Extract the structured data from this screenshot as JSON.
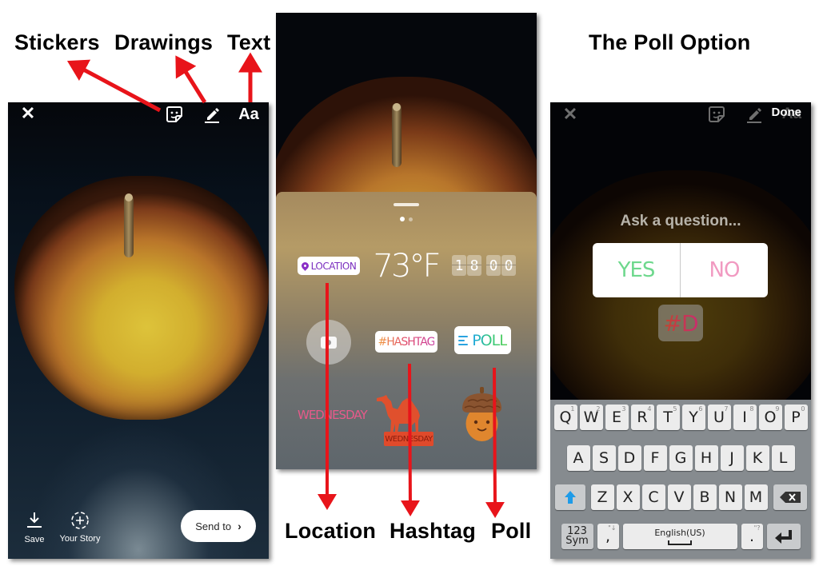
{
  "captions": {
    "stickers": "Stickers",
    "drawings": "Drawings",
    "text": "Text",
    "poll_option": "The Poll Option",
    "location": "Location",
    "hashtag": "Hashtag",
    "poll": "Poll"
  },
  "panel_editor": {
    "close_icon": "close-icon",
    "sticker_icon": "sticker-icon",
    "draw_icon": "pen-icon",
    "text_button": "Aa",
    "save_label": "Save",
    "your_story_label": "Your Story",
    "send_to_label": "Send to",
    "send_to_chevron": "›"
  },
  "panel_stickers": {
    "location_label": "LOCATION",
    "temperature": "73°F",
    "clock_digits": [
      "1",
      "8",
      "0",
      "0"
    ],
    "hashtag_label": "#HASHTAG",
    "poll_label": "POLL",
    "day_sticker": "WEDNESDAY",
    "day_badge": "WEDNESDAY",
    "page_indicator": {
      "current": 1,
      "total": 2
    }
  },
  "panel_poll": {
    "done_label": "Done",
    "text_button": "Aa",
    "question_placeholder": "Ask a question...",
    "option_yes": "YES",
    "option_no": "NO",
    "hashtag_draft": "#D",
    "keyboard": {
      "row1": [
        {
          "key": "Q",
          "sup": "1"
        },
        {
          "key": "W",
          "sup": "2"
        },
        {
          "key": "E",
          "sup": "3"
        },
        {
          "key": "R",
          "sup": "4"
        },
        {
          "key": "T",
          "sup": "5"
        },
        {
          "key": "Y",
          "sup": "6"
        },
        {
          "key": "U",
          "sup": "7"
        },
        {
          "key": "I",
          "sup": "8"
        },
        {
          "key": "O",
          "sup": "9"
        },
        {
          "key": "P",
          "sup": "0"
        }
      ],
      "row2": [
        "A",
        "S",
        "D",
        "F",
        "G",
        "H",
        "J",
        "K",
        "L"
      ],
      "row3": [
        "Z",
        "X",
        "C",
        "V",
        "B",
        "N",
        "M"
      ],
      "sym_top": "123",
      "sym_bottom": "Sym",
      "comma": ",",
      "comma_sup": "\"↓",
      "space_label": "English(US)",
      "period": ".",
      "period_sup": "\"?"
    }
  },
  "colors": {
    "arrow_red": "#e8141a",
    "poll_yes": "#6ed88d",
    "poll_no": "#f19ac1",
    "location_purple": "#7b2fbf",
    "shift_blue": "#1e9be8"
  }
}
